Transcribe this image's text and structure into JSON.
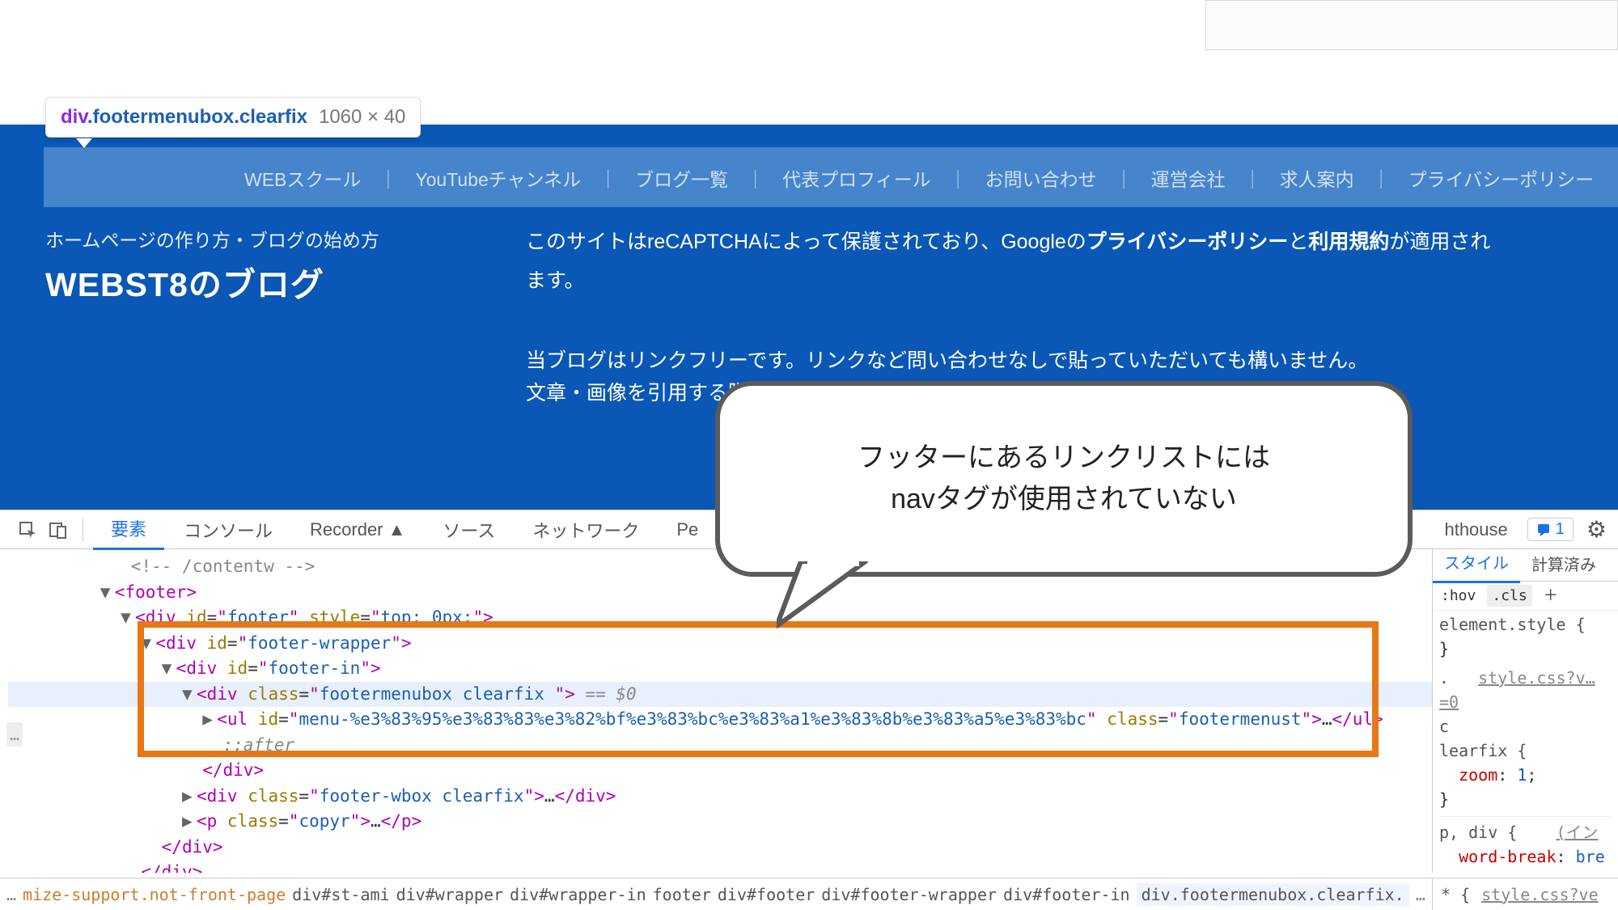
{
  "element_tip": {
    "prefix": "div",
    "classes": ".footermenubox.clearfix",
    "dimensions": "1060 × 40"
  },
  "footer_menu": {
    "items": [
      "WEBスクール",
      "YouTubeチャンネル",
      "ブログ一覧",
      "代表プロフィール",
      "お問い合わせ",
      "運営会社",
      "求人案内",
      "プライバシーポリシー"
    ]
  },
  "crumb_text": "ホームページの作り方・ブログの始め方",
  "blog_title": "WEBST8のブログ",
  "recaptcha": {
    "prefix": "このサイトはreCAPTCHAによって保護されており、Googleの",
    "link1": "プライバシーポリシー",
    "mid": "と",
    "link2": "利用規約",
    "suffix1": "が適用され",
    "suffix2": "ます。"
  },
  "linkfree": {
    "line1": "当ブログはリンクフリーです。リンクなど問い合わせなしで貼っていただいても構いません。",
    "line2": "文章・画像を引用する際は引用元として明示をお願いいたします。"
  },
  "bubble": {
    "line1": "フッターにあるリンクリストには",
    "line2": "navタグが使用されていない"
  },
  "devtools": {
    "tabs": [
      "要素",
      "コンソール",
      "Recorder ▲",
      "ソース",
      "ネットワーク",
      "Pe"
    ],
    "tab_right": "hthouse",
    "msg_count": "1",
    "styles_tabs": [
      "スタイル",
      "計算済み"
    ],
    "toolbar": {
      "hov": ":hov",
      "cls": ".cls",
      "plus": "＋"
    },
    "styles_rules": {
      "elstyle": "element.style {",
      "elstyle_close": "}",
      "src1": "style.css?v…=0",
      "rule1_sel": ".\nc\nlearfix {",
      "rule1_prop": "zoom",
      "rule1_val": "1",
      "rule1_close": "}",
      "rule2_sel": "p, div {",
      "rule2_right": "(イン",
      "rule2_prop": "word-break",
      "rule2_val": "bre",
      "rule2_close": "}",
      "last_sel": "* {",
      "last_src": "style.css?ve"
    },
    "code": {
      "l1": "<!-- /contentw -->",
      "l2_open": "footer",
      "l3_open": "div",
      "l3_attr_id": "footer",
      "l3_attr_style": "top: 0px;",
      "l4_open": "div",
      "l4_attr_id": "footer-wrapper",
      "l5_open": "div",
      "l5_attr_id": "footer-in",
      "l6_open": "div",
      "l6_attr_class": "footermenubox clearfix ",
      "l6_eq": "== $0",
      "l7_open": "ul",
      "l7_attr_id": "menu-%e3%83%95%e3%83%83%e3%82%bf%e3%83%bc%e3%83%a1%e3%83%8b%e3%83%a5%e3%83%bc",
      "l7_attr_class": "footermenust",
      "l7_ell": "…",
      "l8": "::after",
      "l9_close": "div",
      "l10_open": "div",
      "l10_attr_class": "footer-wbox clearfix",
      "l10_ell": "…",
      "l11_open": "p",
      "l11_attr_class": "copyr",
      "l11_ell": "…",
      "l12_close": "div",
      "l13_close": "div"
    },
    "breadcrumbs": [
      "mize-support.not-front-page",
      "div#st-ami",
      "div#wrapper",
      "div#wrapper-in",
      "footer",
      "div#footer",
      "div#footer-wrapper",
      "div#footer-in",
      "div.footermenubox.clearfix."
    ]
  }
}
